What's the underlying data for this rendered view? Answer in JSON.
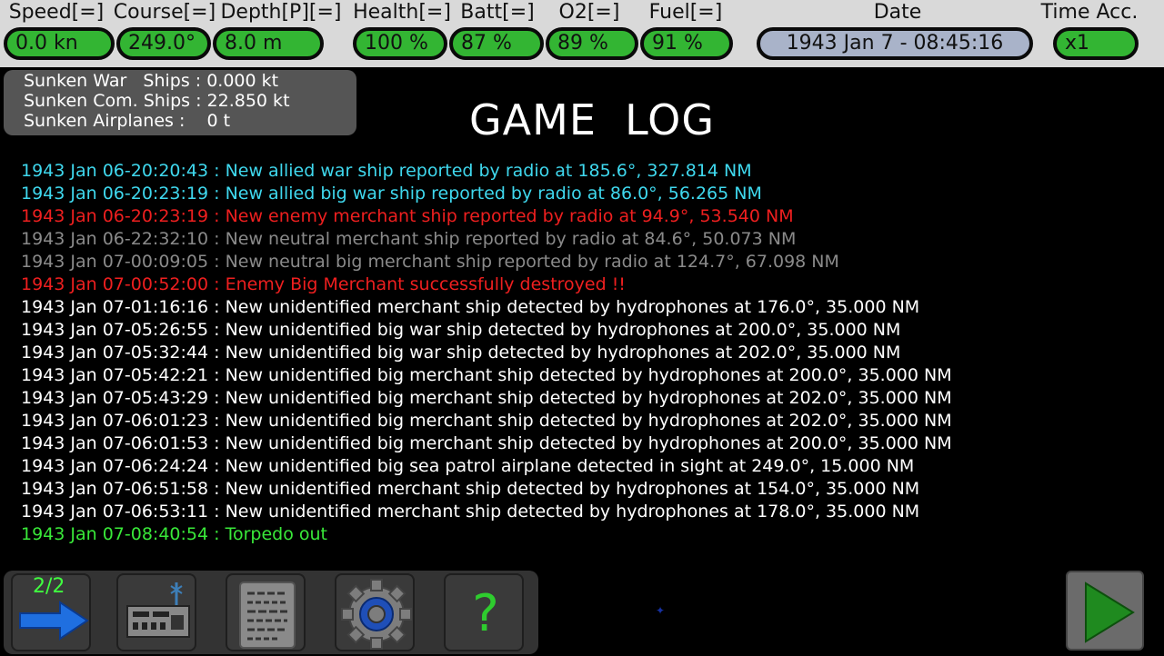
{
  "hud": {
    "speed": {
      "label": "Speed[=]",
      "value": "0.0 kn"
    },
    "course": {
      "label": "Course[=]",
      "value": "249.0°"
    },
    "depth": {
      "label": "Depth[P][=]",
      "value": "8.0 m"
    },
    "health": {
      "label": "Health[=]",
      "value": "100 %"
    },
    "batt": {
      "label": "Batt[=]",
      "value": "87 %"
    },
    "o2": {
      "label": "O2[=]",
      "value": "89 %"
    },
    "fuel": {
      "label": "Fuel[=]",
      "value": "91 %"
    },
    "date": {
      "label": "Date",
      "value": "1943 Jan 7 - 08:45:16"
    },
    "timeacc": {
      "label": "Time Acc.",
      "value": "x1"
    }
  },
  "sunken": {
    "war": "Sunken War   Ships : 0.000 kt",
    "commercial": "Sunken Com. Ships : 22.850 kt",
    "airplanes": "Sunken Airplanes :    0 t"
  },
  "title": "GAME  LOG",
  "colors": {
    "radio_allied": "#3fd8ee",
    "enemy": "#ee1f1f",
    "neutral": "#8a8a8a",
    "detected": "#ffffff",
    "event_ok": "#39e839"
  },
  "log": [
    {
      "text": "1943 Jan 06-20:20:43 : New allied war ship reported by radio at 185.6°, 327.814 NM",
      "color": "#3fd8ee"
    },
    {
      "text": "1943 Jan 06-20:23:19 : New allied big war ship reported by radio at 86.0°, 56.265 NM",
      "color": "#3fd8ee"
    },
    {
      "text": "1943 Jan 06-20:23:19 : New enemy merchant ship reported by radio at 94.9°, 53.540 NM",
      "color": "#ee1f1f"
    },
    {
      "text": "1943 Jan 06-22:32:10 : New neutral merchant ship reported by radio at 84.6°, 50.073 NM",
      "color": "#8a8a8a"
    },
    {
      "text": "1943 Jan 07-00:09:05 : New neutral big merchant ship reported by radio at 124.7°, 67.098 NM",
      "color": "#8a8a8a"
    },
    {
      "text": "1943 Jan 07-00:52:00 : Enemy Big Merchant successfully destroyed !!",
      "color": "#ee1f1f"
    },
    {
      "text": "1943 Jan 07-01:16:16 : New unidentified merchant ship detected by hydrophones at 176.0°, 35.000 NM",
      "color": "#ffffff"
    },
    {
      "text": "1943 Jan 07-05:26:55 : New unidentified big war ship detected by hydrophones at 200.0°, 35.000 NM",
      "color": "#ffffff"
    },
    {
      "text": "1943 Jan 07-05:32:44 : New unidentified big war ship detected by hydrophones at 202.0°, 35.000 NM",
      "color": "#ffffff"
    },
    {
      "text": "1943 Jan 07-05:42:21 : New unidentified big merchant ship detected by hydrophones at 200.0°, 35.000 NM",
      "color": "#ffffff"
    },
    {
      "text": "1943 Jan 07-05:43:29 : New unidentified big merchant ship detected by hydrophones at 202.0°, 35.000 NM",
      "color": "#ffffff"
    },
    {
      "text": "1943 Jan 07-06:01:23 : New unidentified big merchant ship detected by hydrophones at 202.0°, 35.000 NM",
      "color": "#ffffff"
    },
    {
      "text": "1943 Jan 07-06:01:53 : New unidentified big merchant ship detected by hydrophones at 200.0°, 35.000 NM",
      "color": "#ffffff"
    },
    {
      "text": "1943 Jan 07-06:24:24 : New unidentified big sea patrol airplane detected in sight at 249.0°, 15.000 NM",
      "color": "#ffffff"
    },
    {
      "text": "1943 Jan 07-06:51:58 : New unidentified merchant ship detected by hydrophones at 154.0°, 35.000 NM",
      "color": "#ffffff"
    },
    {
      "text": "1943 Jan 07-06:53:11 : New unidentified merchant ship detected by hydrophones at 178.0°, 35.000 NM",
      "color": "#ffffff"
    },
    {
      "text": "1943 Jan 07-08:40:54 : Torpedo out",
      "color": "#39e839"
    }
  ],
  "toolbar": {
    "page_indicator": "2/2",
    "tools": [
      {
        "name": "next-page-arrow-icon"
      },
      {
        "name": "radio-icon"
      },
      {
        "name": "log-scroll-icon"
      },
      {
        "name": "settings-gear-icon"
      },
      {
        "name": "help-question-icon"
      }
    ],
    "help_glyph": "?"
  }
}
